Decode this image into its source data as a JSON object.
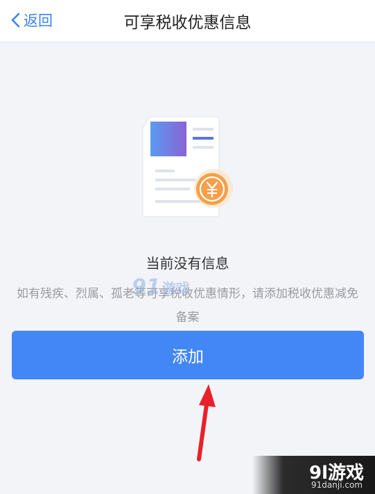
{
  "header": {
    "back_label": "返回",
    "title": "可享税收优惠信息"
  },
  "empty_state": {
    "title": "当前没有信息",
    "description": "如有残疾、烈属、孤老等可享税收优惠情形，请添加税收优惠减免备案",
    "illustration_icon": "document-yen-icon"
  },
  "actions": {
    "add_label": "添加"
  },
  "watermark": {
    "center_number": "91",
    "center_text": "游戏",
    "corner_brand": "9l游戏",
    "corner_domain": "91danji.com"
  },
  "colors": {
    "accent": "#4287f5",
    "link": "#3a82f6",
    "coin": "#f5a04a",
    "arrow": "#e8202a",
    "background": "#f3f4f8"
  }
}
